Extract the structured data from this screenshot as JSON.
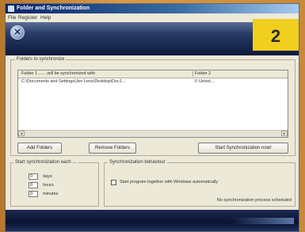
{
  "window": {
    "title": "Folder and Synchronization",
    "menu": [
      "File",
      "Register",
      "Help"
    ]
  },
  "header": {
    "logo_glyph": "✕",
    "badge": "2"
  },
  "folders": {
    "group_label": "Folders to synchronize",
    "columns": [
      "Folder 1 ...... will be synchronized with",
      "Folder 2"
    ],
    "rows": [
      {
        "folder1": "C:\\Documents and Settings\\Jen Lenz\\Desktop\\Doc1...",
        "folder2": "F:\\Jetsd..."
      }
    ],
    "buttons": {
      "add": "Add Folders",
      "remove": "Remove Folders",
      "start": "Start Synchronization now!"
    }
  },
  "schedule": {
    "group_label": "Start synchronization each ...",
    "rows": [
      {
        "value": "0",
        "unit": "days"
      },
      {
        "value": "0",
        "unit": "hours"
      },
      {
        "value": "0",
        "unit": "minutes"
      }
    ]
  },
  "behaviour": {
    "group_label": "Synchronization behaviour",
    "option": "Start program together with Windows automatically",
    "status": "No synchronization process scheduled"
  }
}
